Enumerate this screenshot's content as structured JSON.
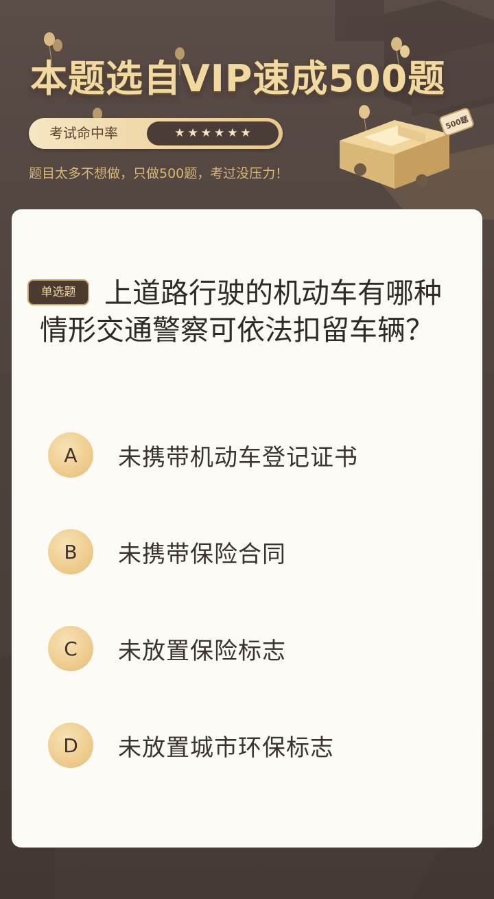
{
  "hero": {
    "title": "本题选自VIP速成500题",
    "rate_label": "考试命中率",
    "stars": 6,
    "subtitle": "题目太多不想做，只做500题，考过没压力！",
    "badge_500": "500题"
  },
  "question": {
    "type_badge": "单选题",
    "text": "上道路行驶的机动车有哪种情形交通警察可依法扣留车辆？"
  },
  "options": [
    {
      "letter": "A",
      "text": "未携带机动车登记证书"
    },
    {
      "letter": "B",
      "text": "未携带保险合同"
    },
    {
      "letter": "C",
      "text": "未放置保险标志"
    },
    {
      "letter": "D",
      "text": "未放置城市环保标志"
    }
  ],
  "colors": {
    "background": "#4e423d",
    "gold": "#f1d9a0",
    "card": "#fcfbf6",
    "badge": "#4b3a2f"
  }
}
